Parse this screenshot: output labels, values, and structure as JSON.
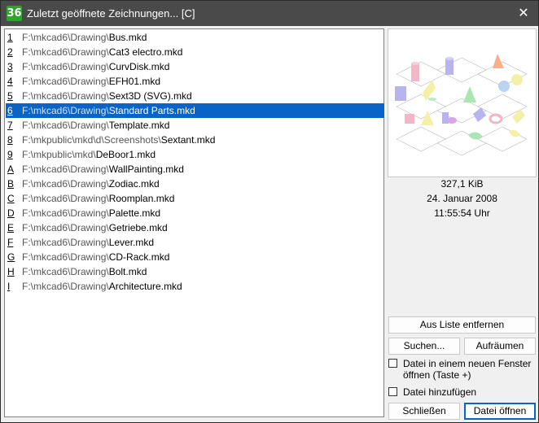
{
  "window": {
    "icon_text": "36",
    "title": "Zuletzt geöffnete Zeichnungen... [C]",
    "close_glyph": "✕"
  },
  "files": [
    {
      "key": "1",
      "path": "F:\\mkcad6\\Drawing\\",
      "name": "Bus.mkd"
    },
    {
      "key": "2",
      "path": "F:\\mkcad6\\Drawing\\",
      "name": "Cat3 electro.mkd"
    },
    {
      "key": "3",
      "path": "F:\\mkcad6\\Drawing\\",
      "name": "CurvDisk.mkd"
    },
    {
      "key": "4",
      "path": "F:\\mkcad6\\Drawing\\",
      "name": "EFH01.mkd"
    },
    {
      "key": "5",
      "path": "F:\\mkcad6\\Drawing\\",
      "name": "Sext3D (SVG).mkd"
    },
    {
      "key": "6",
      "path": "F:\\mkcad6\\Drawing\\",
      "name": "Standard Parts.mkd"
    },
    {
      "key": "7",
      "path": "F:\\mkcad6\\Drawing\\",
      "name": "Template.mkd"
    },
    {
      "key": "8",
      "path": "F:\\mkpublic\\mkd\\d\\Screenshots\\",
      "name": "Sextant.mkd"
    },
    {
      "key": "9",
      "path": "F:\\mkpublic\\mkd\\",
      "name": "DeBoor1.mkd"
    },
    {
      "key": "A",
      "path": "F:\\mkcad6\\Drawing\\",
      "name": "WallPainting.mkd"
    },
    {
      "key": "B",
      "path": "F:\\mkcad6\\Drawing\\",
      "name": "Zodiac.mkd"
    },
    {
      "key": "C",
      "path": "F:\\mkcad6\\Drawing\\",
      "name": "Roomplan.mkd"
    },
    {
      "key": "D",
      "path": "F:\\mkcad6\\Drawing\\",
      "name": "Palette.mkd"
    },
    {
      "key": "E",
      "path": "F:\\mkcad6\\Drawing\\",
      "name": "Getriebe.mkd"
    },
    {
      "key": "F",
      "path": "F:\\mkcad6\\Drawing\\",
      "name": "Lever.mkd"
    },
    {
      "key": "G",
      "path": "F:\\mkcad6\\Drawing\\",
      "name": "CD-Rack.mkd"
    },
    {
      "key": "H",
      "path": "F:\\mkcad6\\Drawing\\",
      "name": "Bolt.mkd"
    },
    {
      "key": "I",
      "path": "F:\\mkcad6\\Drawing\\",
      "name": "Architecture.mkd"
    }
  ],
  "selected_key": "6",
  "details": {
    "size": "327,1 KiB",
    "date": "24. Januar 2008",
    "time": "11:55:54 Uhr"
  },
  "buttons": {
    "remove": "Aus Liste entfernen",
    "search": "Suchen...",
    "cleanup": "Aufräumen",
    "close": "Schließen",
    "open": "Datei öffnen"
  },
  "checkboxes": {
    "new_window": {
      "line1": "Datei in einem neuen Fenster",
      "line2": "öffnen (Taste +)",
      "checked": false
    },
    "add_file": {
      "label": "Datei hinzufügen",
      "checked": false
    }
  },
  "colors": {
    "selection": "#0a64c8",
    "titlebar": "#4a4a4a",
    "app_icon": "#2ea42e"
  }
}
